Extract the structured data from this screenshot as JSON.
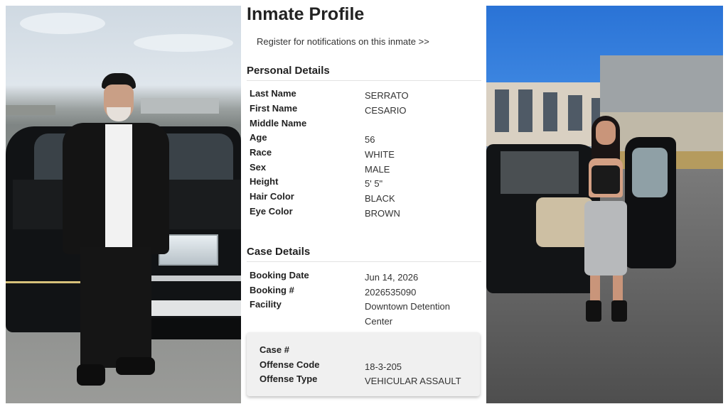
{
  "title": "Inmate Profile",
  "notify_link": "Register for notifications on this inmate >>",
  "personal": {
    "heading": "Personal Details",
    "fields": [
      {
        "label": "Last Name",
        "value": "SERRATO"
      },
      {
        "label": "First Name",
        "value": "CESARIO"
      },
      {
        "label": "Middle Name",
        "value": ""
      },
      {
        "label": "Age",
        "value": "56"
      },
      {
        "label": "Race",
        "value": "WHITE"
      },
      {
        "label": "Sex",
        "value": "MALE"
      },
      {
        "label": "Height",
        "value": "5' 5\""
      },
      {
        "label": "Hair Color",
        "value": "BLACK"
      },
      {
        "label": "Eye Color",
        "value": "BROWN"
      }
    ]
  },
  "case": {
    "heading": "Case Details",
    "fields": [
      {
        "label": "Booking Date",
        "value": "Jun 14, 2026"
      },
      {
        "label": "Booking #",
        "value": "2026535090"
      },
      {
        "label": "Facility",
        "value": "Downtown Detention Center"
      }
    ],
    "box": [
      {
        "label": "Case #",
        "value": ""
      },
      {
        "label": "Offense Code",
        "value": "18-3-205"
      },
      {
        "label": "Offense Type",
        "value": "VEHICULAR ASSAULT"
      }
    ]
  }
}
